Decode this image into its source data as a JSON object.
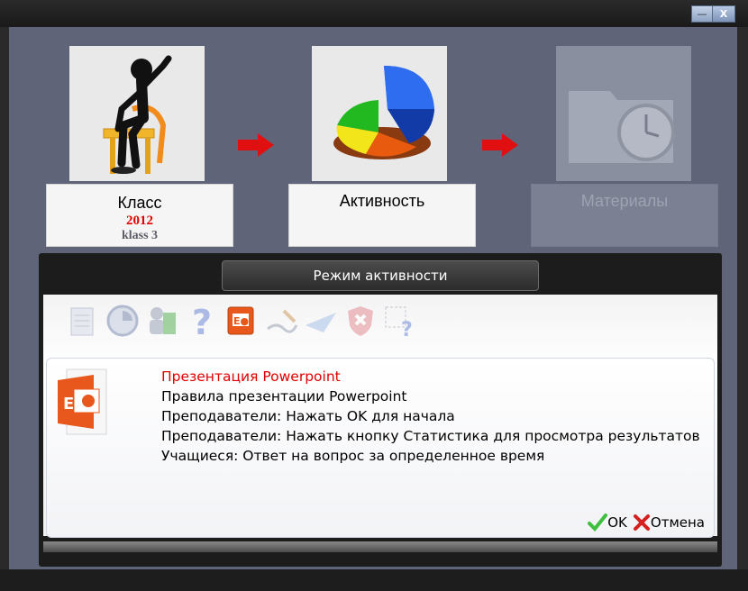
{
  "window": {
    "minimize_label": "—",
    "close_label": "X"
  },
  "steps": [
    {
      "title": "Класс",
      "year": "2012",
      "subtitle": "klass 3",
      "icon": "sitting-figure-icon",
      "state": "done"
    },
    {
      "title": "Активность",
      "icon": "pie-chart-icon",
      "state": "current"
    },
    {
      "title": "Материалы",
      "icon": "folder-clock-icon",
      "state": "disabled"
    }
  ],
  "dialog": {
    "header": "Режим активности",
    "toolbar_icons": [
      "calendar-icon",
      "clock-chart-icon",
      "teacher-book-icon",
      "question-icon",
      "powerpoint-icon",
      "signature-icon",
      "paper-plane-icon",
      "shield-error-icon",
      "question-form-icon"
    ],
    "selected_icon": "powerpoint-icon",
    "info": {
      "title": "Презентация Powerpoint",
      "lines": [
        "Правила презентации Powerpoint",
        "Преподаватели: Нажать OK для начала",
        "Преподаватели: Нажать кнопку Статистика для просмотра результатов",
        "Учащиеся: Ответ на вопрос за определенное время"
      ]
    },
    "ok_label": "OK",
    "cancel_label": "Отмена"
  },
  "colors": {
    "background": "#5f6478",
    "accent_red": "#e30000",
    "ok_green": "#3fbf3f",
    "cancel_red": "#d62020"
  }
}
